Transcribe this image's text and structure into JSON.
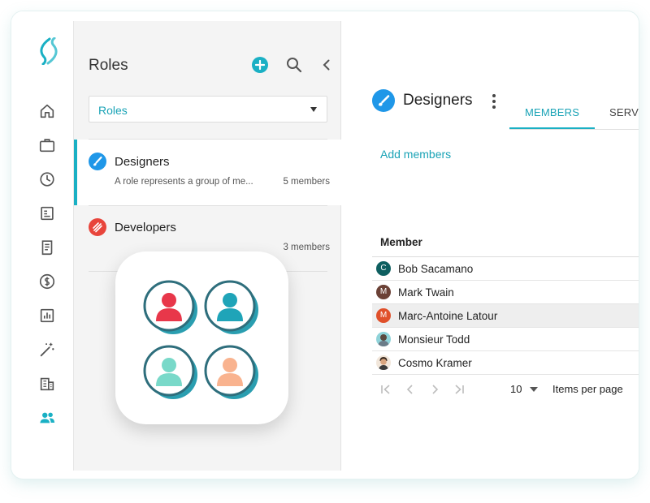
{
  "colors": {
    "accent": "#1ab0c4",
    "accent_text": "#1aa3b6",
    "designers_icon": "#1f97e8",
    "developers_icon": "#e8453c"
  },
  "rail": {
    "items": [
      {
        "icon": "home-icon"
      },
      {
        "icon": "briefcase-icon"
      },
      {
        "icon": "clock-icon"
      },
      {
        "icon": "document-icon"
      },
      {
        "icon": "receipt-icon"
      },
      {
        "icon": "dollar-icon"
      },
      {
        "icon": "chart-icon"
      },
      {
        "icon": "magic-wand-icon"
      },
      {
        "icon": "building-icon"
      },
      {
        "icon": "people-icon",
        "active": true
      }
    ]
  },
  "panel": {
    "title": "Roles",
    "filter": {
      "selected": "Roles"
    },
    "roles": [
      {
        "name": "Designers",
        "description": "A role represents a group of me...",
        "count": "5 members",
        "icon": "paintbrush-icon",
        "active": true
      },
      {
        "name": "Developers",
        "description": "",
        "count": "3 members",
        "icon": "code-icon",
        "active": false
      }
    ]
  },
  "main": {
    "role_title": "Designers",
    "tabs": [
      {
        "label": "MEMBERS",
        "active": true
      },
      {
        "label": "SERV",
        "active": false
      }
    ],
    "add_members": "Add members",
    "table": {
      "header": "Member",
      "rows": [
        {
          "initial": "C",
          "name": "Bob Sacamano",
          "avatar_color": "#0e5f60"
        },
        {
          "initial": "M",
          "name": "Mark Twain",
          "avatar_color": "#6b4136"
        },
        {
          "initial": "M",
          "name": "Marc-Antoine Latour",
          "avatar_color": "#e0502a",
          "highlighted": true
        },
        {
          "initial": "",
          "name": "Monsieur Todd",
          "avatar_color": "#7d8c96"
        },
        {
          "initial": "",
          "name": "Cosmo Kramer",
          "avatar_color": "#8a6a55"
        }
      ]
    },
    "pager": {
      "page_size": "10",
      "items_per_page_label": "Items per page"
    }
  }
}
